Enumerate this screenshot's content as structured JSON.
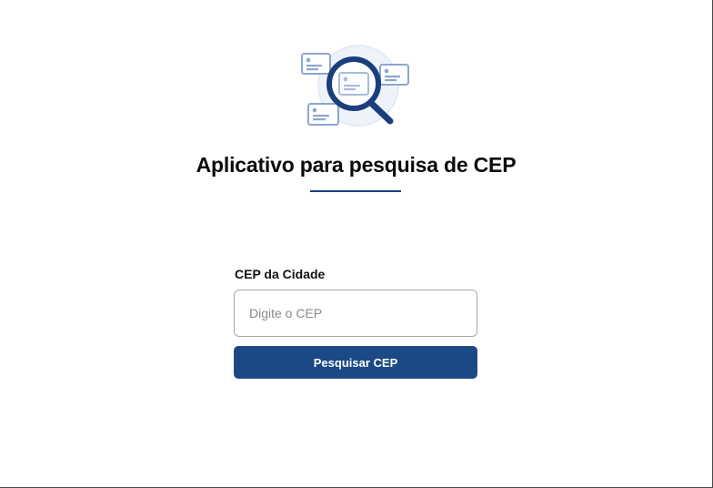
{
  "header": {
    "illustration_icon": "cep-search-illustration-icon",
    "title": "Aplicativo para pesquisa de CEP"
  },
  "form": {
    "cep_label": "CEP da Cidade",
    "cep_input_value": "",
    "cep_input_placeholder": "Digite o CEP",
    "search_button_label": "Pesquisar CEP"
  },
  "colors": {
    "accent": "#1a4985",
    "illustration_light": "#8ea6cf",
    "illustration_dark": "#1b3f7c",
    "title_text": "#0b0b0b"
  }
}
